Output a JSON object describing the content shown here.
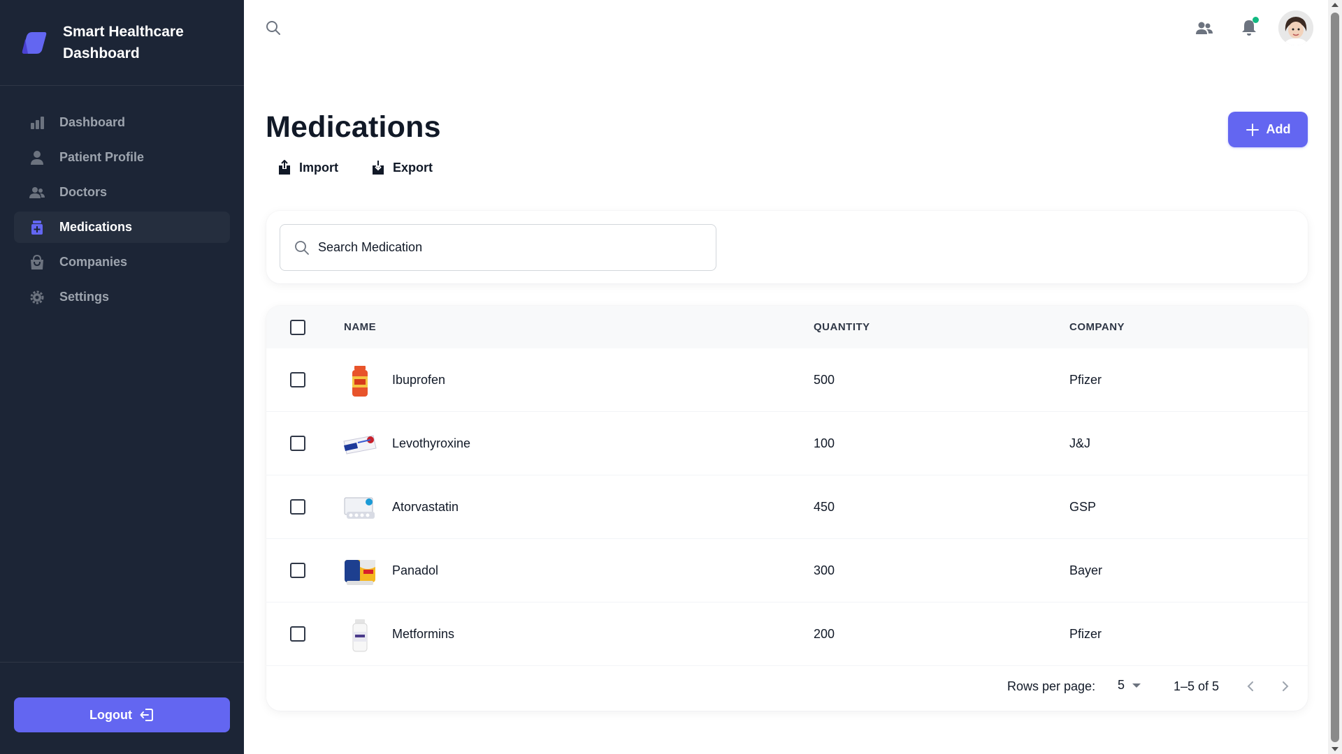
{
  "brand": {
    "name_line1": "Smart Healthcare",
    "name_line2": "Dashboard",
    "accent": "#6366f1"
  },
  "sidebar": {
    "items": [
      {
        "label": "Dashboard",
        "icon": "bar-chart-icon",
        "active": false
      },
      {
        "label": "Patient Profile",
        "icon": "user-icon",
        "active": false
      },
      {
        "label": "Doctors",
        "icon": "users-icon",
        "active": false
      },
      {
        "label": "Medications",
        "icon": "medication-icon",
        "active": true
      },
      {
        "label": "Companies",
        "icon": "shopping-bag-icon",
        "active": false
      },
      {
        "label": "Settings",
        "icon": "gear-icon",
        "active": false
      }
    ],
    "logout_label": "Logout"
  },
  "topbar": {
    "search_icon": "search-icon",
    "contacts_icon": "contacts-icon",
    "bell_icon": "bell-icon",
    "has_notification": true
  },
  "page": {
    "title": "Medications",
    "import_label": "Import",
    "export_label": "Export",
    "add_label": "Add"
  },
  "search": {
    "placeholder": "Search Medication"
  },
  "table": {
    "columns": [
      "NAME",
      "QUANTITY",
      "COMPANY"
    ],
    "rows": [
      {
        "name": "Ibuprofen",
        "quantity": "500",
        "company": "Pfizer",
        "image": "orange-bottle"
      },
      {
        "name": "Levothyroxine",
        "quantity": "100",
        "company": "J&J",
        "image": "blister-box"
      },
      {
        "name": "Atorvastatin",
        "quantity": "450",
        "company": "GSP",
        "image": "pill-box"
      },
      {
        "name": "Panadol",
        "quantity": "300",
        "company": "Bayer",
        "image": "panadol-box"
      },
      {
        "name": "Metformins",
        "quantity": "200",
        "company": "Pfizer",
        "image": "white-bottle"
      }
    ],
    "rows_per_page_label": "Rows per page:",
    "rows_per_page_value": "5",
    "page_range": "1–5 of 5"
  }
}
